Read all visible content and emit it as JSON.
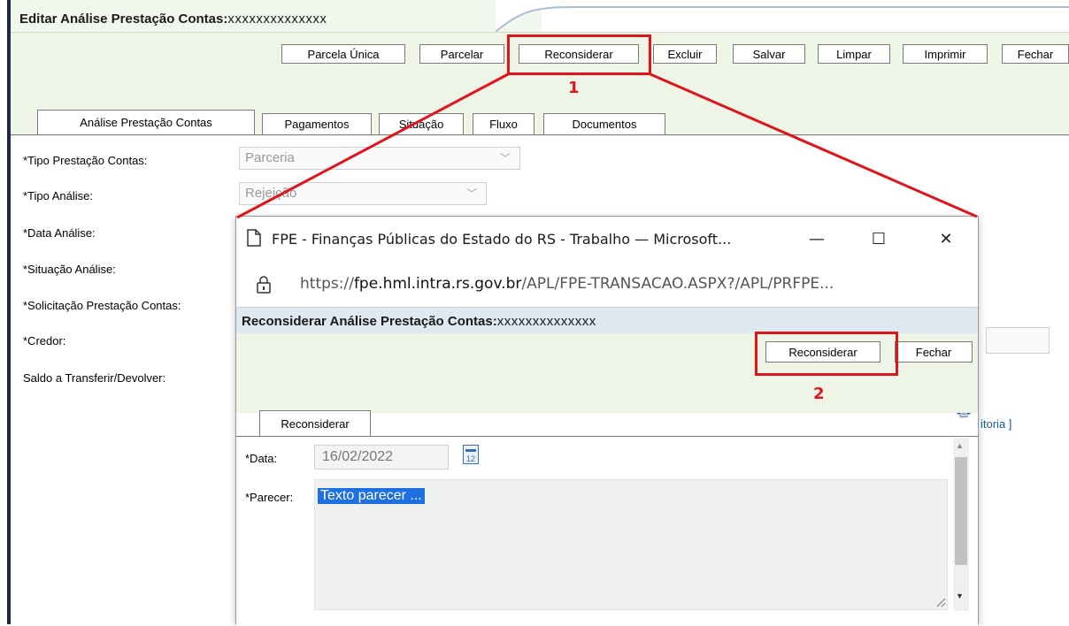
{
  "main": {
    "title_label": "Editar Análise Prestação Contas:",
    "title_id": "xxxxxxxxxxxxxx",
    "buttons": {
      "parcela_unica": "Parcela Única",
      "parcelar": "Parcelar",
      "reconsiderar": "Reconsiderar",
      "excluir": "Excluir",
      "salvar": "Salvar",
      "limpar": "Limpar",
      "imprimir": "Imprimir",
      "fechar": "Fechar"
    },
    "tabs": [
      "Análise Prestação Contas",
      "Pagamentos",
      "Situação",
      "Fluxo",
      "Documentos"
    ],
    "fields": {
      "tipo_prestacao_label": "*Tipo Prestação Contas:",
      "tipo_prestacao_value": "Parceria",
      "tipo_analise_label": "*Tipo Análise:",
      "tipo_analise_value": "Rejeição",
      "data_analise_label": "*Data Análise:",
      "situacao_analise_label": "*Situação Análise:",
      "solicitacao_label": "*Solicitação Prestação Contas:",
      "credor_label": "*Credor:",
      "saldo_label": "Saldo a Transferir/Devolver:",
      "auditoria_link": "itoria ]"
    }
  },
  "annotations": {
    "step1": "1",
    "step2": "2",
    "color": "#e0141b"
  },
  "popup": {
    "window_title": "FPE - Finanças Públicas do Estado do RS - Trabalho — Microsoft...",
    "url_prefix": "https://",
    "url_host": "fpe.hml.intra.rs.gov.br",
    "url_path": "/APL/FPE-TRANSACAO.ASPX?/APL/PRFPE...",
    "header_label": "Reconsiderar Análise Prestação Contas:",
    "header_id": "xxxxxxxxxxxxxx",
    "buttons": {
      "reconsiderar": "Reconsiderar",
      "fechar": "Fechar"
    },
    "tab": "Reconsiderar",
    "data_label": "*Data:",
    "data_value": "16/02/2022",
    "calendar_day": "12",
    "parecer_label": "*Parecer:",
    "parecer_value": "Texto parecer ..."
  },
  "icons": {
    "page": "page-icon",
    "lock": "lock-icon",
    "minimize": "minimize-icon",
    "maximize": "maximize-icon",
    "close": "close-icon",
    "print": "printer-icon",
    "calendar": "calendar-icon",
    "chevron": "chevron-down-icon"
  }
}
